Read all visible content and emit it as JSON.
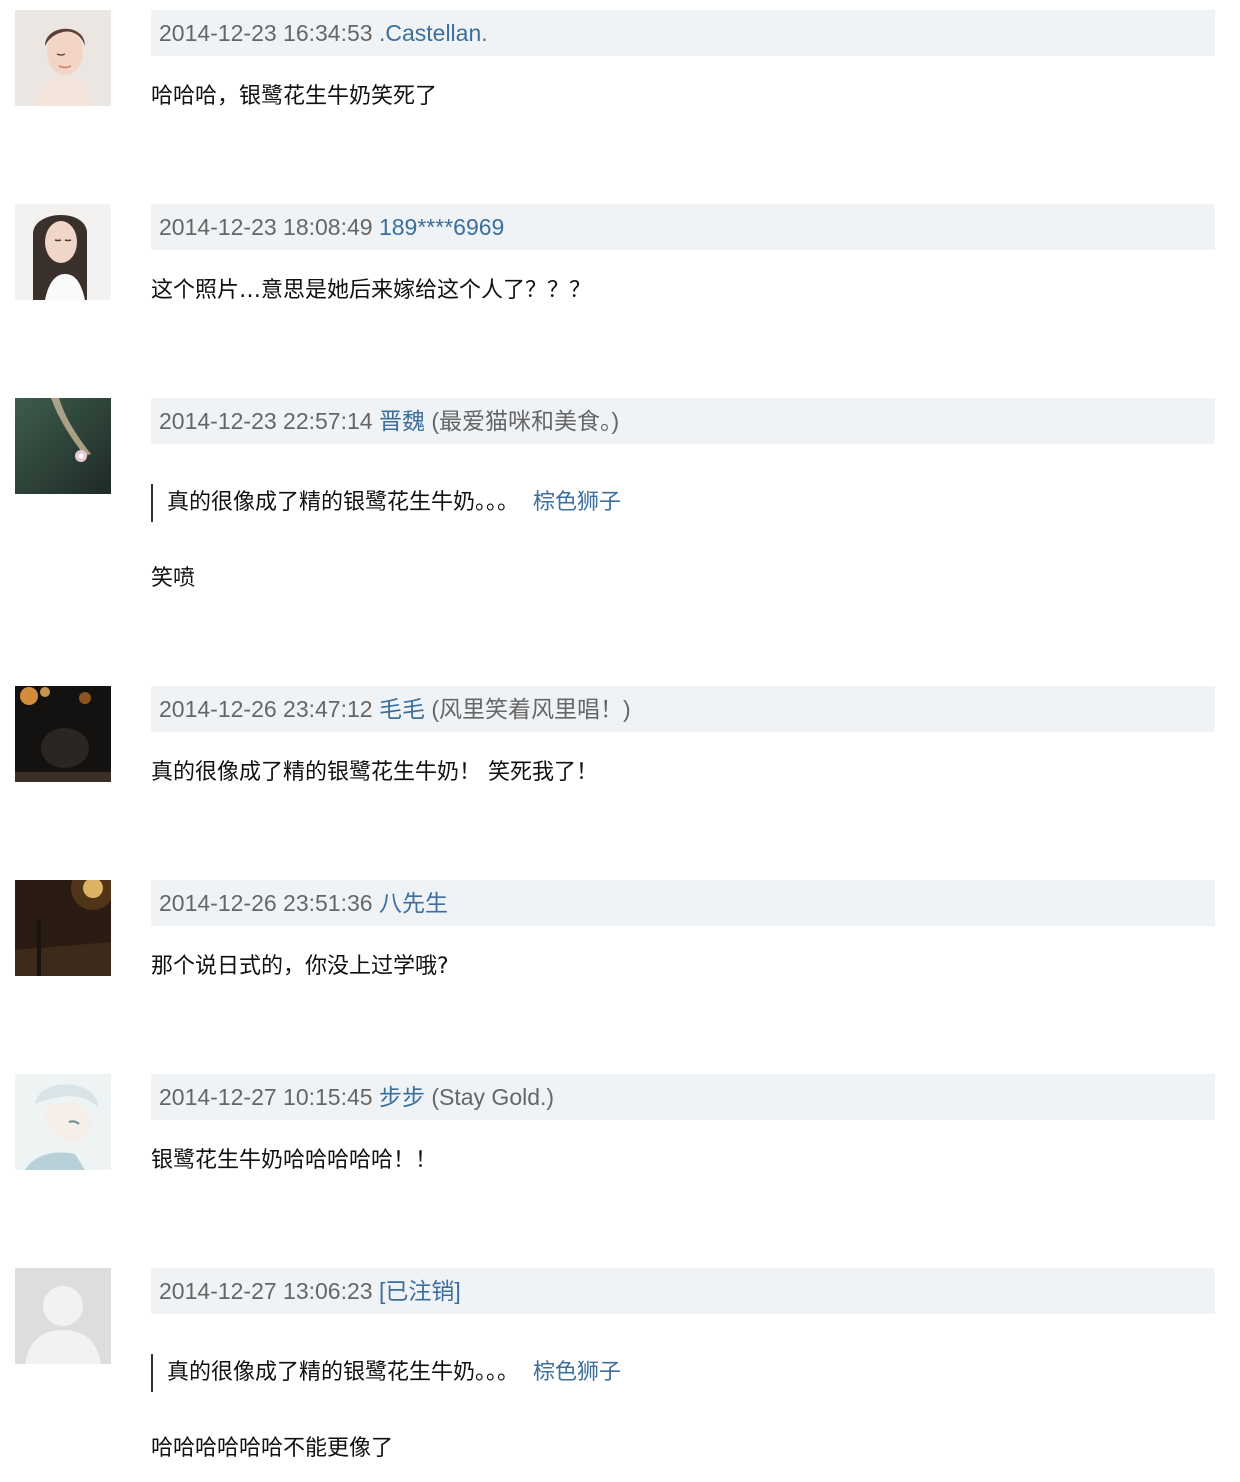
{
  "comments": [
    {
      "time": "2014-12-23 16:34:53",
      "user": ".Castellan.",
      "signature": "",
      "quote": null,
      "text": "哈哈哈，银鹭花生牛奶笑死了",
      "avatar": "woman-portrait-avatar"
    },
    {
      "time": "2014-12-23 18:08:49",
      "user": "189****6969",
      "signature": "",
      "quote": null,
      "text": "这个照片…意思是她后来嫁给这个人了？？？",
      "avatar": "woman-long-hair-avatar"
    },
    {
      "time": "2014-12-23 22:57:14",
      "user": "晋魏",
      "signature": "(最爱猫咪和美食。)",
      "quote": {
        "text": "真的很像成了精的银鹭花生牛奶。。。",
        "author": "棕色狮子"
      },
      "text": "笑喷",
      "avatar": "hand-with-ring-avatar"
    },
    {
      "time": "2014-12-26 23:47:12",
      "user": "毛毛",
      "signature": "(风里笑着风里唱！)",
      "quote": null,
      "text": "真的很像成了精的银鹭花生牛奶！ 笑死我了！",
      "avatar": "night-scene-avatar"
    },
    {
      "time": "2014-12-26 23:51:36",
      "user": "八先生",
      "signature": "",
      "quote": null,
      "text": "那个说日式的，你没上过学哦?",
      "avatar": "street-light-avatar"
    },
    {
      "time": "2014-12-27 10:15:45",
      "user": "步步",
      "signature": "(Stay Gold.)",
      "quote": null,
      "text": "银鹭花生牛奶哈哈哈哈哈！！",
      "avatar": "anime-boy-avatar"
    },
    {
      "time": "2014-12-27 13:06:23",
      "user": "[已注销]",
      "signature": "",
      "quote": {
        "text": "真的很像成了精的银鹭花生牛奶。。。",
        "author": "棕色狮子"
      },
      "text": "哈哈哈哈哈哈不能更像了",
      "avatar": "default-user-avatar"
    }
  ]
}
